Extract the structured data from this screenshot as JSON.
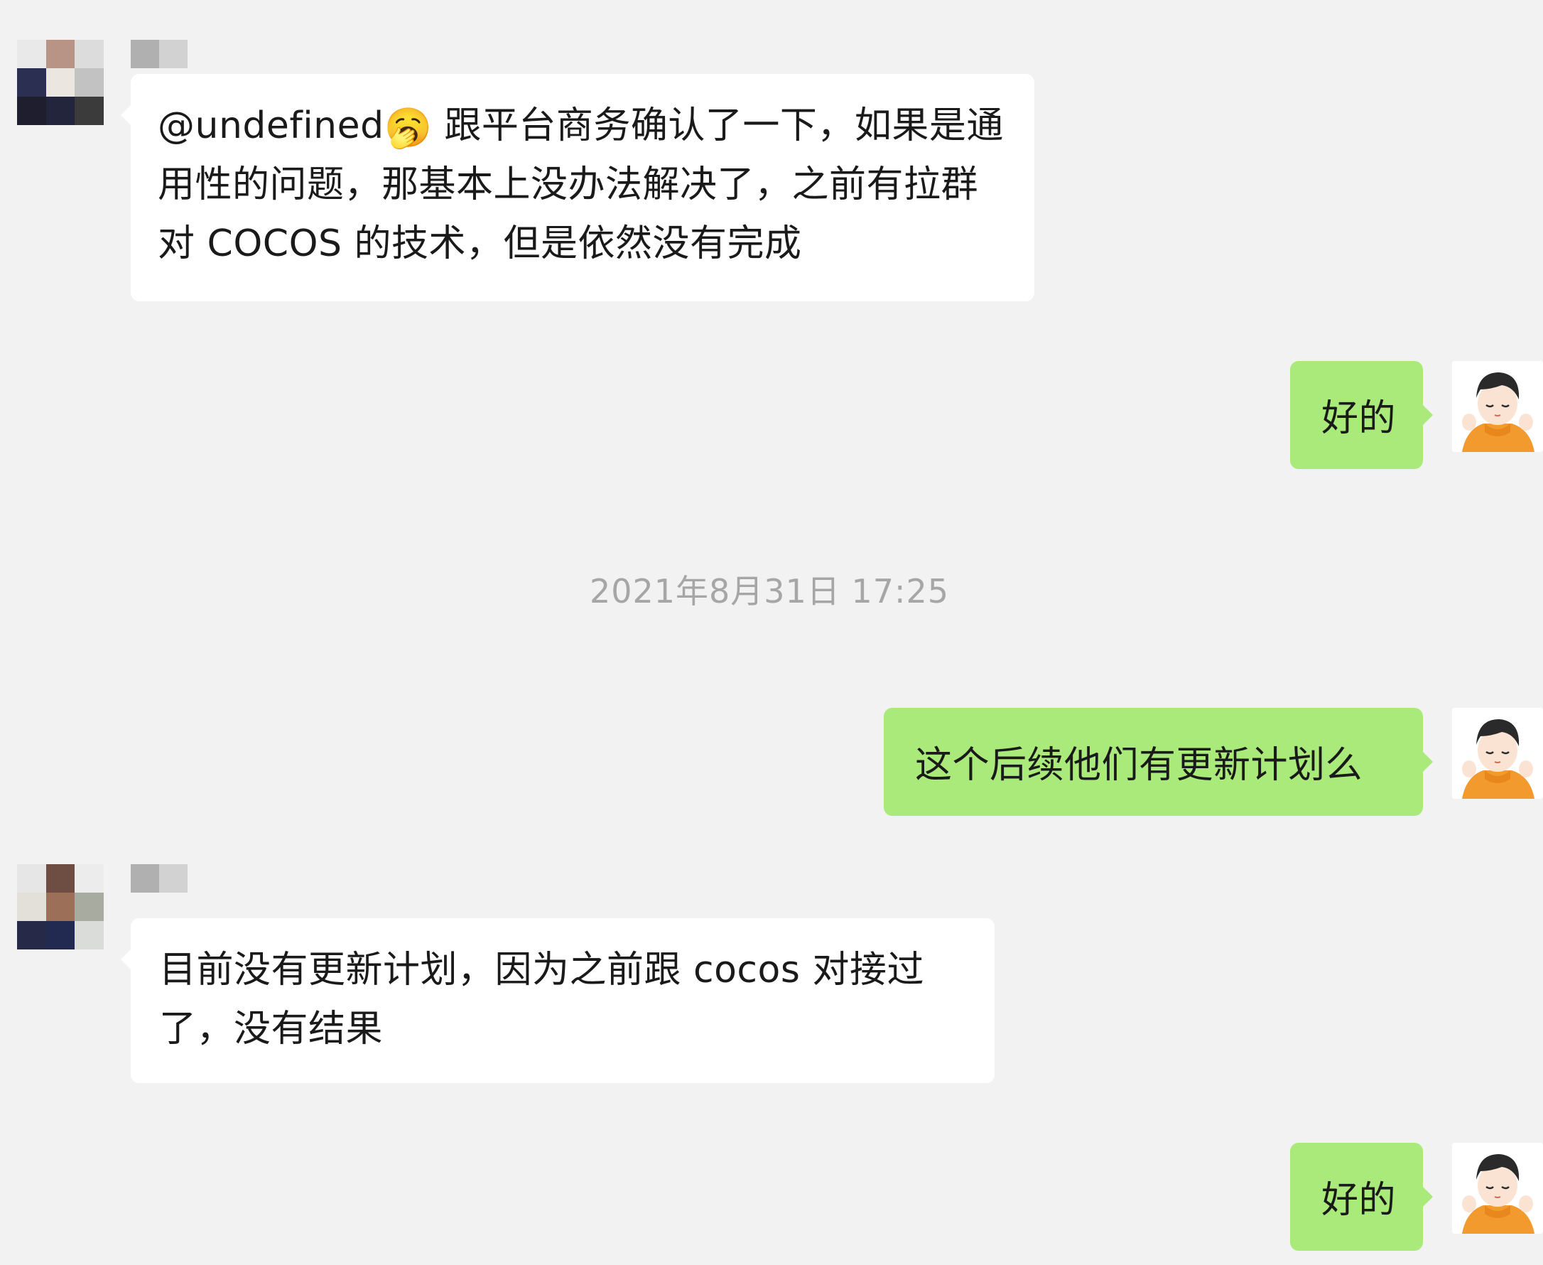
{
  "messages": [
    {
      "side": "left",
      "name": "",
      "mention": "@undefined",
      "emoji": "🥱",
      "text": " 跟平台商务确认了一下，如果是通用性的问题，那基本上没办法解决了，之前有拉群对 COCOS 的技术，但是依然没有完成"
    },
    {
      "side": "right",
      "text": "好的"
    },
    {
      "side": "right",
      "text": "这个后续他们有更新计划么"
    },
    {
      "side": "left",
      "name": "",
      "text": "目前没有更新计划，因为之前跟 cocos 对接过了，没有结果"
    },
    {
      "side": "right",
      "text": "好的"
    }
  ],
  "timestamp": "2021年8月31日 17:25",
  "icons": {
    "contact_avatar": "pixelated-contact-avatar",
    "self_avatar": "cartoon-boy-orange-sweater-avatar"
  },
  "colors": {
    "background": "#f2f2f2",
    "incoming_bubble": "#ffffff",
    "outgoing_bubble": "#a9ea7a",
    "timestamp": "#a6a6a6"
  }
}
